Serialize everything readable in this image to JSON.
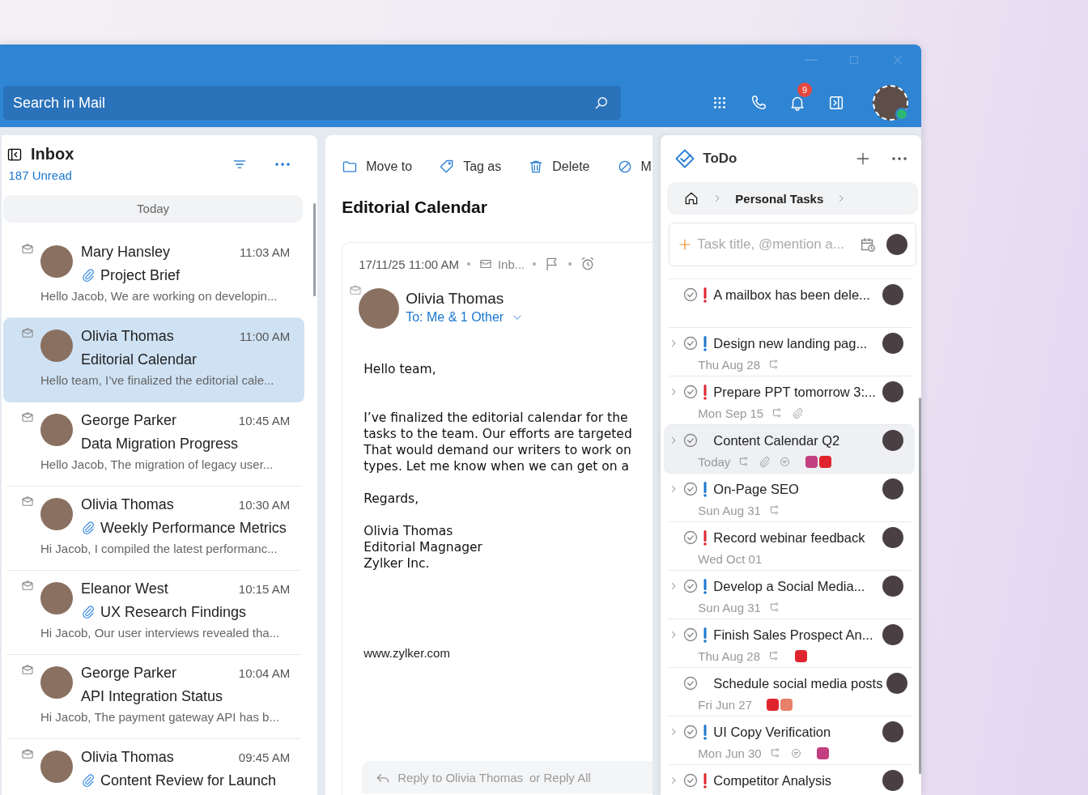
{
  "search": {
    "placeholder": "Search in Mail"
  },
  "notifications": {
    "count": "9"
  },
  "inbox": {
    "title": "Inbox",
    "unread": "187 Unread",
    "group": "Today",
    "messages": [
      {
        "sender": "Mary Hansley",
        "time": "11:03 AM",
        "subject": "Project Brief",
        "attachment": true,
        "preview": "Hello Jacob, We are working on developin...",
        "selected": false
      },
      {
        "sender": "Olivia Thomas",
        "time": "11:00 AM",
        "subject": "Editorial Calendar",
        "attachment": false,
        "preview": "Hello team, I’ve finalized the editorial cale...",
        "selected": true
      },
      {
        "sender": "George Parker",
        "time": "10:45 AM",
        "subject": "Data Migration Progress",
        "attachment": false,
        "preview": "Hello Jacob, The migration of legacy user...",
        "selected": false
      },
      {
        "sender": "Olivia Thomas",
        "time": "10:30 AM",
        "subject": "Weekly Performance Metrics",
        "attachment": true,
        "preview": "Hi Jacob, I compiled the latest performanc...",
        "selected": false
      },
      {
        "sender": "Eleanor West",
        "time": "10:15 AM",
        "subject": "UX Research Findings",
        "attachment": true,
        "preview": "Hi Jacob, Our user interviews revealed tha...",
        "selected": false
      },
      {
        "sender": "George Parker",
        "time": "10:04 AM",
        "subject": "API Integration Status",
        "attachment": false,
        "preview": "Hi Jacob, The payment gateway API has b...",
        "selected": false
      },
      {
        "sender": "Olivia Thomas",
        "time": "09:45 AM",
        "subject": "Content Review for Launch",
        "attachment": true,
        "selected": false
      }
    ]
  },
  "reader": {
    "toolbar": [
      {
        "kind": "move",
        "label": "Move to"
      },
      {
        "kind": "tag",
        "label": "Tag as"
      },
      {
        "kind": "delete",
        "label": "Delete"
      },
      {
        "kind": "block",
        "label": "M"
      }
    ],
    "subject": "Editorial Calendar",
    "date": "17/11/25 11:00 AM",
    "folder": "Inb...",
    "sender": "Olivia Thomas",
    "recipients": "To: Me & 1 Other",
    "body": [
      "Hello team,",
      "I’ve finalized the editorial calendar for the\ntasks to the team. Our efforts are targeted\nThat would demand our writers to work on\ntypes. Let me know when we can get on a",
      "Regards,",
      "Olivia Thomas\nEditorial Magnager\nZylker Inc."
    ],
    "website": "www.zylker.com",
    "reply": {
      "to": "Reply to Olivia Thomas",
      "all": "or Reply All"
    }
  },
  "todo": {
    "title": "ToDo",
    "breadcrumb": "Personal Tasks",
    "new_task": {
      "placeholder": "Task title, @mention a..."
    },
    "tasks": [
      {
        "title": "A mailbox has been dele...",
        "priority": {
          "color": "#e0242e"
        },
        "expandable": false,
        "hovered": false
      },
      {
        "title": "Design new landing pag...",
        "priority": {
          "color": "#1a78d0"
        },
        "expandable": true,
        "hovered": false,
        "date": "Thu Aug 28",
        "subtasks": true,
        "attachment": false,
        "comments": false
      },
      {
        "title": "Prepare PPT tomorrow 3:...",
        "priority": {
          "color": "#e0242e"
        },
        "expandable": true,
        "hovered": false,
        "date": "Mon Sep 15",
        "subtasks": true,
        "attachment": true,
        "comments": false
      },
      {
        "title": "Content Calendar Q2",
        "expandable": true,
        "hovered": true,
        "date": "Today",
        "subtasks": true,
        "attachment": true,
        "comments": true,
        "tags": [
          {
            "color": "#c2407f"
          },
          {
            "color": "#e0242e"
          }
        ]
      },
      {
        "title": "On-Page SEO",
        "priority": {
          "color": "#1a78d0"
        },
        "expandable": true,
        "hovered": false,
        "date": "Sun Aug 31",
        "subtasks": true,
        "attachment": false,
        "comments": false
      },
      {
        "title": "Record webinar feedback",
        "priority": {
          "color": "#e0242e"
        },
        "expandable": false,
        "hovered": false,
        "date": "Wed Oct 01",
        "subtasks": false,
        "attachment": false,
        "comments": false
      },
      {
        "title": "Develop a Social Media...",
        "priority": {
          "color": "#1a78d0"
        },
        "expandable": true,
        "hovered": false,
        "date": "Sun Aug 31",
        "subtasks": true,
        "attachment": false,
        "comments": false
      },
      {
        "title": "Finish Sales Prospect An...",
        "priority": {
          "color": "#1a78d0"
        },
        "expandable": true,
        "hovered": false,
        "date": "Thu Aug 28",
        "subtasks": true,
        "attachment": false,
        "comments": false,
        "tags": [
          {
            "color": "#e0242e"
          }
        ]
      },
      {
        "title": "Schedule social media posts",
        "expandable": false,
        "hovered": false,
        "date": "Fri Jun 27",
        "subtasks": false,
        "attachment": false,
        "comments": false,
        "tags": [
          {
            "color": "#e0242e"
          },
          {
            "color": "#e8806a"
          }
        ]
      },
      {
        "title": "UI Copy Verification",
        "priority": {
          "color": "#1a78d0"
        },
        "expandable": true,
        "hovered": false,
        "date": "Mon Jun 30",
        "subtasks": true,
        "attachment": false,
        "comments": true,
        "tags": [
          {
            "color": "#c2407f"
          }
        ]
      },
      {
        "title": "Competitor Analysis",
        "priority": {
          "color": "#e0242e"
        },
        "expandable": true,
        "hovered": false
      }
    ]
  }
}
